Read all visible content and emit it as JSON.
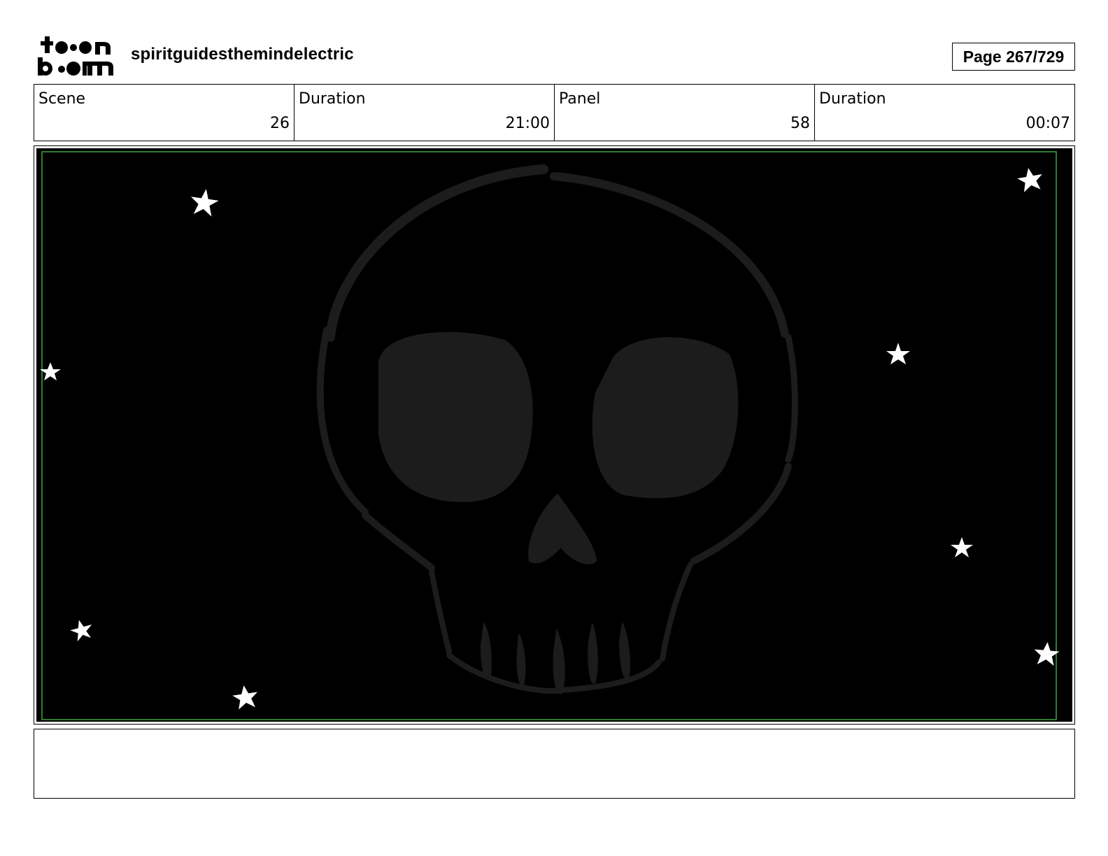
{
  "header": {
    "logo_text": "toon boom",
    "project_title": "spiritguidesthemindelectric",
    "page_indicator": "Page 267/729"
  },
  "info": {
    "scene_label": "Scene",
    "scene_value": "26",
    "scene_duration_label": "Duration",
    "scene_duration_value": "21:00",
    "panel_label": "Panel",
    "panel_value": "58",
    "panel_duration_label": "Duration",
    "panel_duration_value": "00:07"
  },
  "panel": {
    "background_color": "#000000",
    "safe_frame_color": "#2e7d32",
    "skull_color": "#1c1c1c",
    "star_color": "#ffffff",
    "icons": [
      "skull-drawing",
      "star-icon"
    ]
  },
  "caption": {
    "text": ""
  }
}
